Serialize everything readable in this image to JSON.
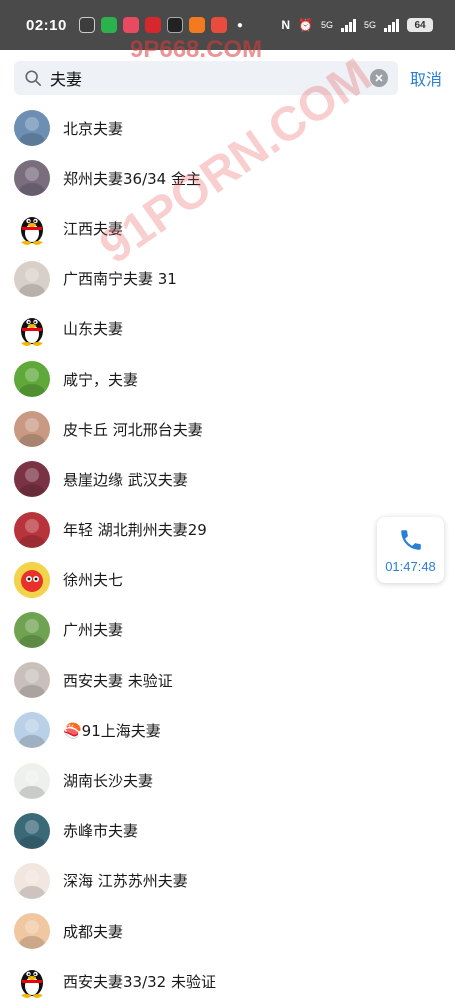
{
  "status_bar": {
    "time": "02:10",
    "battery": "64",
    "network_1": "5G",
    "network_2": "5G"
  },
  "search": {
    "value": "夫妻",
    "placeholder": "",
    "cancel_label": "取消"
  },
  "results": [
    {
      "name": "北京夫妻",
      "avatar_color": "#6d8fb3"
    },
    {
      "name": "郑州夫妻36/34  金主",
      "avatar_color": "#7a6d7e"
    },
    {
      "name": "江西夫妻",
      "avatar_color": "#ffffff",
      "avatar_icon": "penguin"
    },
    {
      "name": "广西南宁夫妻 31",
      "avatar_color": "#d9cfc9"
    },
    {
      "name": "山东夫妻",
      "avatar_color": "#ffffff",
      "avatar_icon": "penguin"
    },
    {
      "name": "咸宁，夫妻",
      "avatar_color": "#5fa83a"
    },
    {
      "name": "皮卡丘  河北邢台夫妻",
      "avatar_color": "#c89a84"
    },
    {
      "name": "悬崖边缘 武汉夫妻",
      "avatar_color": "#7a3344"
    },
    {
      "name": "年轻 湖北荆州夫妻29",
      "avatar_color": "#b8343c"
    },
    {
      "name": "徐州夫七",
      "avatar_color": "#f0d24a",
      "avatar_icon": "bird"
    },
    {
      "name": "广州夫妻",
      "avatar_color": "#6fa351"
    },
    {
      "name": "西安夫妻 未验证",
      "avatar_color": "#c9c0bb"
    },
    {
      "name": "🍣91上海夫妻",
      "avatar_color": "#b9d0e6"
    },
    {
      "name": "湖南长沙夫妻",
      "avatar_color": "#eef0ee"
    },
    {
      "name": "赤峰市夫妻",
      "avatar_color": "#3a6a78"
    },
    {
      "name": "深海 江苏苏州夫妻",
      "avatar_color": "#f2e6e0"
    },
    {
      "name": "成都夫妻",
      "avatar_color": "#efc7a0"
    },
    {
      "name": "西安夫妻33/32 未验证",
      "avatar_color": "#ffffff",
      "avatar_icon": "penguin"
    }
  ],
  "call_widget": {
    "timer": "01:47:48",
    "icon": "phone-icon"
  },
  "watermarks": [
    "9P668.COM",
    "91PORN.COM"
  ],
  "colors": {
    "accent": "#2a7fd4",
    "status_bar": "#4a4a4a",
    "search_bg": "#eef1f5"
  }
}
